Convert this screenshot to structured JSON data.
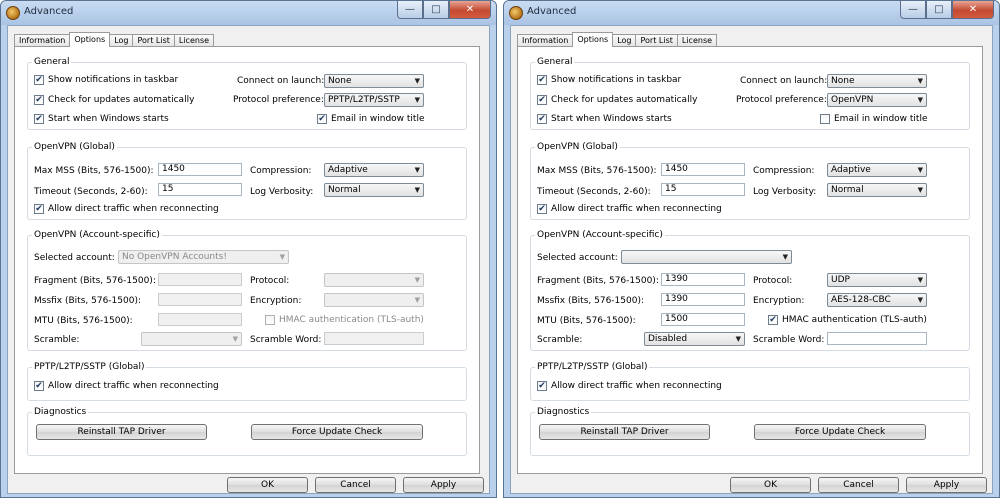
{
  "windows": [
    {
      "title": "Advanced",
      "tabs": [
        "Information",
        "Options",
        "Log",
        "Port List",
        "License"
      ],
      "active_tab": "Options",
      "general": {
        "label": "General",
        "show_notifications": {
          "label": "Show notifications in taskbar",
          "checked": true
        },
        "check_updates": {
          "label": "Check for updates automatically",
          "checked": true
        },
        "start_windows": {
          "label": "Start when Windows starts",
          "checked": true
        },
        "connect_on_launch": {
          "label": "Connect on launch:",
          "value": "None"
        },
        "protocol_pref": {
          "label": "Protocol preference:",
          "value": "PPTP/L2TP/SSTP"
        },
        "email_title": {
          "label": "Email in window title",
          "checked": true
        }
      },
      "openvpn_global": {
        "label": "OpenVPN (Global)",
        "max_mss": {
          "label": "Max MSS (Bits, 576-1500):",
          "value": "1450"
        },
        "timeout": {
          "label": "Timeout (Seconds, 2-60):",
          "value": "15"
        },
        "compression": {
          "label": "Compression:",
          "value": "Adaptive"
        },
        "log_verbosity": {
          "label": "Log Verbosity:",
          "value": "Normal"
        },
        "allow_direct": {
          "label": "Allow direct traffic when reconnecting",
          "checked": true
        }
      },
      "openvpn_account": {
        "label": "OpenVPN (Account-specific)",
        "selected_account": {
          "label": "Selected account:",
          "value": "No OpenVPN Accounts!"
        },
        "fragment": {
          "label": "Fragment (Bits, 576-1500):",
          "value": ""
        },
        "mssfix": {
          "label": "Mssfix (Bits, 576-1500):",
          "value": ""
        },
        "mtu": {
          "label": "MTU (Bits, 576-1500):",
          "value": ""
        },
        "scramble": {
          "label": "Scramble:",
          "value": ""
        },
        "protocol": {
          "label": "Protocol:",
          "value": ""
        },
        "encryption": {
          "label": "Encryption:",
          "value": ""
        },
        "hmac": {
          "label": "HMAC authentication (TLS-auth)",
          "checked": false
        },
        "scramble_word": {
          "label": "Scramble Word:",
          "value": ""
        },
        "enabled": false
      },
      "pptp_global": {
        "label": "PPTP/L2TP/SSTP (Global)",
        "allow_direct": {
          "label": "Allow direct traffic when reconnecting",
          "checked": true
        }
      },
      "diagnostics": {
        "label": "Diagnostics",
        "reinstall_tap": "Reinstall TAP Driver",
        "force_update": "Force Update Check"
      },
      "buttons": {
        "ok": "OK",
        "cancel": "Cancel",
        "apply": "Apply"
      }
    },
    {
      "title": "Advanced",
      "tabs": [
        "Information",
        "Options",
        "Log",
        "Port List",
        "License"
      ],
      "active_tab": "Options",
      "general": {
        "label": "General",
        "show_notifications": {
          "label": "Show notifications in taskbar",
          "checked": true
        },
        "check_updates": {
          "label": "Check for updates automatically",
          "checked": true
        },
        "start_windows": {
          "label": "Start when Windows starts",
          "checked": true
        },
        "connect_on_launch": {
          "label": "Connect on launch:",
          "value": "None"
        },
        "protocol_pref": {
          "label": "Protocol preference:",
          "value": "OpenVPN"
        },
        "email_title": {
          "label": "Email in window title",
          "checked": false
        }
      },
      "openvpn_global": {
        "label": "OpenVPN (Global)",
        "max_mss": {
          "label": "Max MSS (Bits, 576-1500):",
          "value": "1450"
        },
        "timeout": {
          "label": "Timeout (Seconds, 2-60):",
          "value": "15"
        },
        "compression": {
          "label": "Compression:",
          "value": "Adaptive"
        },
        "log_verbosity": {
          "label": "Log Verbosity:",
          "value": "Normal"
        },
        "allow_direct": {
          "label": "Allow direct traffic when reconnecting",
          "checked": true
        }
      },
      "openvpn_account": {
        "label": "OpenVPN (Account-specific)",
        "selected_account": {
          "label": "Selected account:",
          "value": ""
        },
        "fragment": {
          "label": "Fragment (Bits, 576-1500):",
          "value": "1390"
        },
        "mssfix": {
          "label": "Mssfix (Bits, 576-1500):",
          "value": "1390"
        },
        "mtu": {
          "label": "MTU (Bits, 576-1500):",
          "value": "1500"
        },
        "scramble": {
          "label": "Scramble:",
          "value": "Disabled"
        },
        "protocol": {
          "label": "Protocol:",
          "value": "UDP"
        },
        "encryption": {
          "label": "Encryption:",
          "value": "AES-128-CBC"
        },
        "hmac": {
          "label": "HMAC authentication (TLS-auth)",
          "checked": true
        },
        "scramble_word": {
          "label": "Scramble Word:",
          "value": ""
        },
        "enabled": true
      },
      "pptp_global": {
        "label": "PPTP/L2TP/SSTP (Global)",
        "allow_direct": {
          "label": "Allow direct traffic when reconnecting",
          "checked": true
        }
      },
      "diagnostics": {
        "label": "Diagnostics",
        "reinstall_tap": "Reinstall TAP Driver",
        "force_update": "Force Update Check"
      },
      "buttons": {
        "ok": "OK",
        "cancel": "Cancel",
        "apply": "Apply"
      }
    }
  ]
}
